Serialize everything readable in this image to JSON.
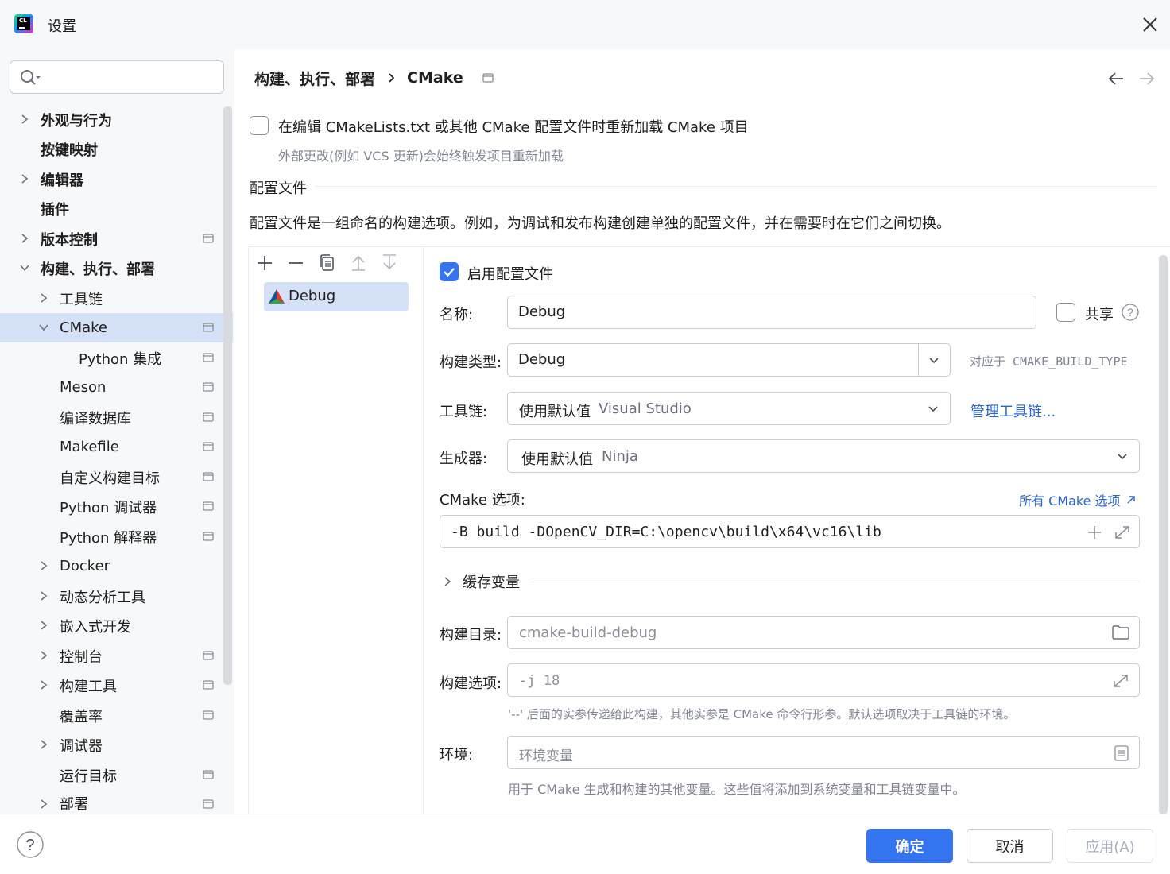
{
  "window": {
    "title": "设置",
    "app_icon_text": "CL"
  },
  "breadcrumb": {
    "parent": "构建、执行、部署",
    "current": "CMake"
  },
  "sidebar": {
    "items": [
      {
        "label": "外观与行为"
      },
      {
        "label": "按键映射"
      },
      {
        "label": "编辑器"
      },
      {
        "label": "插件"
      },
      {
        "label": "版本控制"
      },
      {
        "label": "构建、执行、部署"
      },
      {
        "label": "工具链"
      },
      {
        "label": "CMake"
      },
      {
        "label": "Python 集成"
      },
      {
        "label": "Meson"
      },
      {
        "label": "编译数据库"
      },
      {
        "label": "Makefile"
      },
      {
        "label": "自定义构建目标"
      },
      {
        "label": "Python 调试器"
      },
      {
        "label": "Python 解释器"
      },
      {
        "label": "Docker"
      },
      {
        "label": "动态分析工具"
      },
      {
        "label": "嵌入式开发"
      },
      {
        "label": "控制台"
      },
      {
        "label": "构建工具"
      },
      {
        "label": "覆盖率"
      },
      {
        "label": "调试器"
      },
      {
        "label": "运行目标"
      },
      {
        "label": "部署"
      }
    ]
  },
  "reload": {
    "label": "在编辑 CMakeLists.txt 或其他 CMake 配置文件时重新加载 CMake 项目",
    "hint": "外部更改(例如 VCS 更新)会始终触发项目重新加载"
  },
  "profiles": {
    "section_title": "配置文件",
    "description": "配置文件是一组命名的构建选项。例如，为调试和发布构建创建单独的配置文件，并在需要时在它们之间切换。",
    "list": [
      "Debug"
    ]
  },
  "form": {
    "enable_label": "启用配置文件",
    "name_label": "名称:",
    "name_value": "Debug",
    "share_label": "共享",
    "build_type_label": "构建类型:",
    "build_type_value": "Debug",
    "build_type_hint": "对应于 CMAKE_BUILD_TYPE",
    "toolchain_label": "工具链:",
    "toolchain_value": "使用默认值",
    "toolchain_detail": "Visual Studio",
    "manage_toolchains": "管理工具链...",
    "generator_label": "生成器:",
    "generator_value": "使用默认值",
    "generator_detail": "Ninja",
    "cmake_options_label": "CMake 选项:",
    "all_cmake_options": "所有 CMake 选项",
    "cmake_options_value": "-B build -DOpenCV_DIR=C:\\opencv\\build\\x64\\vc16\\lib",
    "cache_vars_label": "缓存变量",
    "build_dir_label": "构建目录:",
    "build_dir_placeholder": "cmake-build-debug",
    "build_options_label": "构建选项:",
    "build_options_placeholder": "-j 18",
    "build_options_hint": "'--' 后面的实参传递给此构建，其他实参是 CMake 命令行形参。默认选项取决于工具链的环境。",
    "env_label": "环境:",
    "env_placeholder": "环境变量",
    "env_hint": "用于 CMake 生成和构建的其他变量。这些值将添加到系统变量和工具链变量中。"
  },
  "footer": {
    "ok": "确定",
    "cancel": "取消",
    "apply": "应用(A)"
  },
  "colors": {
    "accent": "#3574f0",
    "link": "#2a64d6",
    "selection": "#d5e1f6"
  }
}
